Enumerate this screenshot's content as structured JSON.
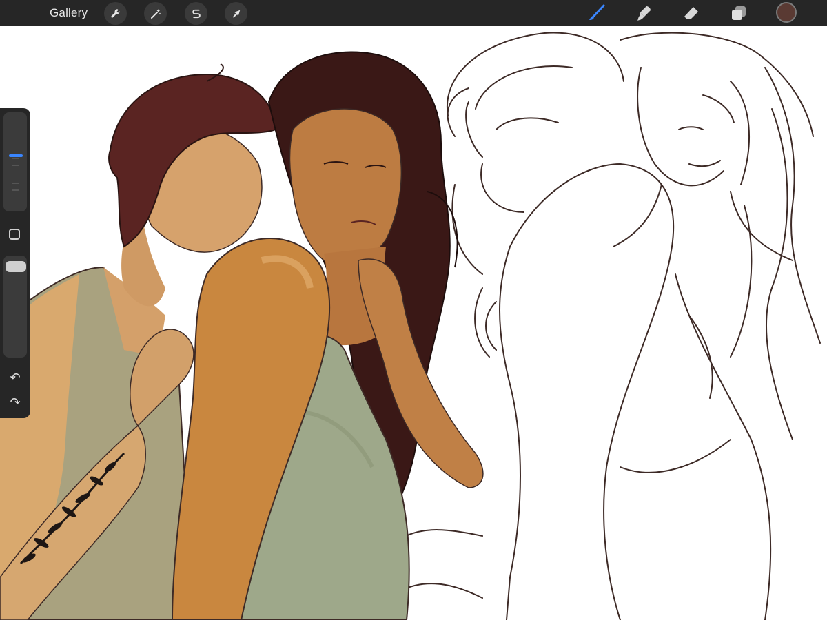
{
  "topbar": {
    "gallery_label": "Gallery",
    "left_tools": [
      {
        "name": "actions",
        "icon": "wrench-icon"
      },
      {
        "name": "adjustments",
        "icon": "magic-wand-icon"
      },
      {
        "name": "selection",
        "icon": "selection-s-icon"
      },
      {
        "name": "transform",
        "icon": "arrow-cursor-icon"
      }
    ],
    "right_tools": [
      {
        "name": "brush",
        "icon": "brush-icon",
        "active": true
      },
      {
        "name": "smudge",
        "icon": "smudge-icon"
      },
      {
        "name": "eraser",
        "icon": "eraser-icon"
      },
      {
        "name": "layers",
        "icon": "layers-icon"
      }
    ],
    "current_color": "#5a3a33",
    "active_tool_color": "#3a86ff"
  },
  "sidebar": {
    "brush_size_level": 0.58,
    "opacity_level": 0.97,
    "modify_icon": "square-modify-icon",
    "undo_icon": "undo-icon",
    "redo_icon": "redo-icon"
  },
  "canvas": {
    "background": "#ffffff",
    "line_color": "#3d2a26",
    "skin_light": "#d4a06a",
    "skin_dark": "#b9783f",
    "hair_a": "#4a1e1c",
    "hair_b": "#2a1412",
    "dress_green": "#9ea88a",
    "tank_olive": "#a9a27f"
  }
}
